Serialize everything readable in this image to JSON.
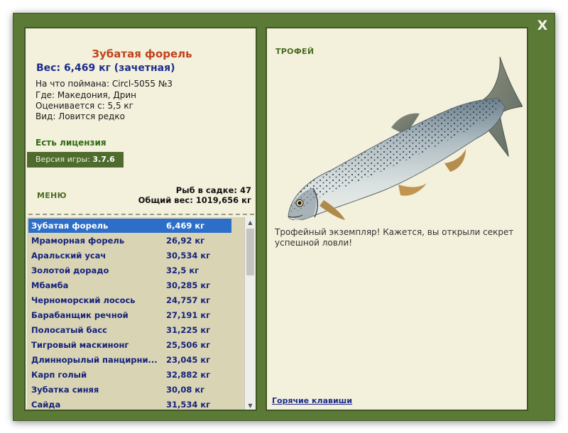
{
  "window": {
    "close_glyph": "X"
  },
  "fish": {
    "name": "Зубатая форель",
    "weight": "Вес: 6,469 кг (зачетная)",
    "caught_on": "На что поймана: Circl-5055 №3",
    "location": "Где: Македония, Дрин",
    "valued_from": "Оценивается с: 5,5 кг",
    "rarity": "Вид: Ловится редко"
  },
  "license": "Есть лицензия",
  "version": {
    "label": "Версия игры:",
    "value": "3.7.6"
  },
  "menu_label": "МЕНЮ",
  "stats": {
    "keepnet": "Рыб в садке: 47",
    "total_weight": "Общий вес: 1019,656 кг"
  },
  "catch_list": {
    "selected_index": 0,
    "items": [
      {
        "name": "Зубатая форель",
        "weight": "6,469 кг"
      },
      {
        "name": "Мраморная форель",
        "weight": "26,92 кг"
      },
      {
        "name": "Аральский усач",
        "weight": "30,534 кг"
      },
      {
        "name": "Золотой дорадо",
        "weight": "32,5 кг"
      },
      {
        "name": "Мбамба",
        "weight": "30,285 кг"
      },
      {
        "name": "Черноморский лосось",
        "weight": "24,757 кг"
      },
      {
        "name": "Барабанщик речной",
        "weight": "27,191 кг"
      },
      {
        "name": "Полосатый басс",
        "weight": "31,225 кг"
      },
      {
        "name": "Тигровый маскинонг",
        "weight": "25,506 кг"
      },
      {
        "name": "Длиннорылый панцирни...",
        "weight": "23,045 кг"
      },
      {
        "name": "Карп голый",
        "weight": "32,882 кг"
      },
      {
        "name": "Зубатка синяя",
        "weight": "30,08 кг"
      },
      {
        "name": "Сайда",
        "weight": "31,534 кг"
      }
    ]
  },
  "trophy": {
    "label": "ТРОФЕЙ",
    "description": "Трофейный экземпляр! Кажется, вы открыли секрет успешной ловли!"
  },
  "hotkeys_label": "Горячие клавиши",
  "icons": {
    "fish_image": "trout-photo",
    "scroll_up": "up-arrow-icon",
    "scroll_down": "down-arrow-icon"
  },
  "colors": {
    "frame": "#5a7a36",
    "panel": "#f3f0dc",
    "list_bg": "#d8d4b4",
    "selection": "#2d6ec8",
    "title": "#c0441c",
    "link": "#1c2c8c"
  }
}
